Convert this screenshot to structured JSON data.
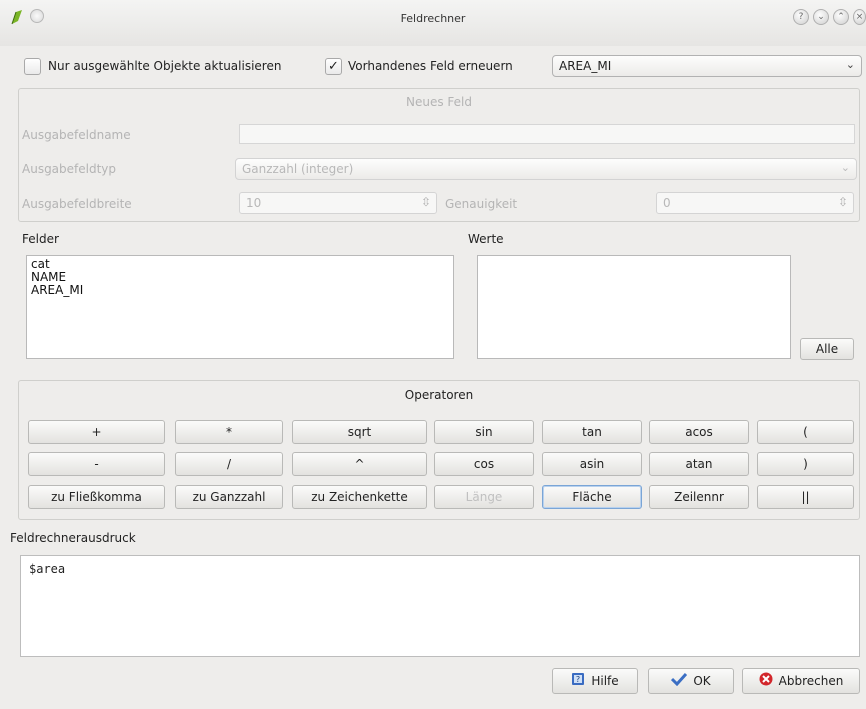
{
  "window": {
    "title": "Feldrechner"
  },
  "top_row": {
    "only_selected_label": "Nur ausgewählte Objekte aktualisieren",
    "update_existing_label": "Vorhandenes Feld erneuern",
    "update_existing_checked": true,
    "existing_field_value": "AREA_MI"
  },
  "new_field": {
    "group_title": "Neues Feld",
    "name_label": "Ausgabefeldname",
    "name_value": "",
    "type_label": "Ausgabefeldtyp",
    "type_value": "Ganzzahl (integer)",
    "width_label": "Ausgabefeldbreite",
    "width_value": "10",
    "precision_label": "Genauigkeit",
    "precision_value": "0"
  },
  "fields": {
    "label": "Felder",
    "items": [
      "cat",
      "NAME",
      "AREA_MI"
    ]
  },
  "values": {
    "label": "Werte",
    "all_button": "Alle"
  },
  "operators": {
    "group_title": "Operatoren",
    "row1": [
      "+",
      "*",
      "sqrt",
      "sin",
      "tan",
      "acos",
      "("
    ],
    "row2": [
      "-",
      "/",
      "^",
      "cos",
      "asin",
      "atan",
      ")"
    ],
    "row3": [
      "zu Fließkomma",
      "zu Ganzzahl",
      "zu Zeichenkette",
      "Länge",
      "Fläche",
      "Zeilennr",
      "||"
    ]
  },
  "expression": {
    "label": "Feldrechnerausdruck",
    "text": "$area"
  },
  "buttons": {
    "help": "Hilfe",
    "ok": "OK",
    "cancel": "Abbrechen"
  }
}
